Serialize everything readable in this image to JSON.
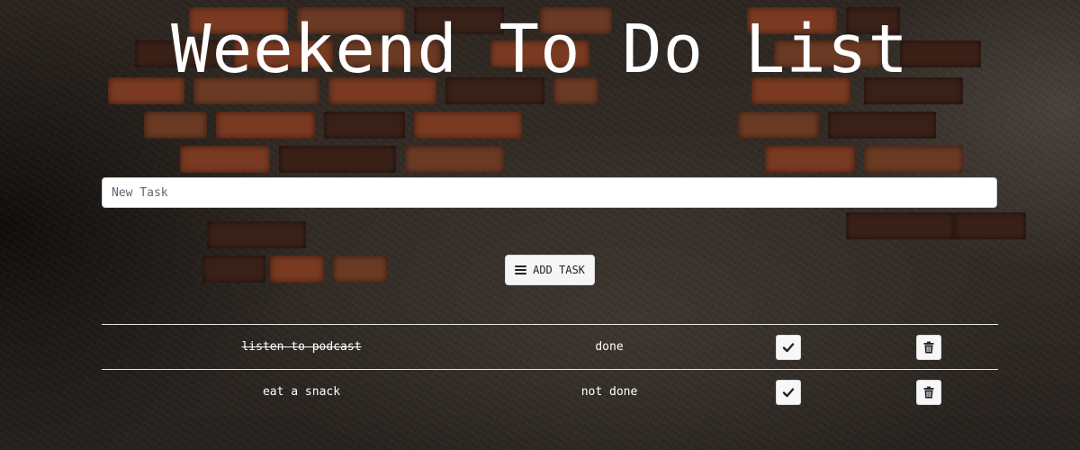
{
  "header": {
    "title": "Weekend To Do List"
  },
  "form": {
    "task_placeholder": "New Task",
    "task_value": "",
    "add_button_label": "ADD TASK",
    "add_button_icon": "bars-icon"
  },
  "tasks": [
    {
      "name": "listen to podcast",
      "status": "done",
      "completed": true,
      "complete_icon": "check-icon",
      "delete_icon": "trash-icon"
    },
    {
      "name": "eat a snack",
      "status": "not done",
      "completed": false,
      "complete_icon": "check-icon",
      "delete_icon": "trash-icon"
    }
  ],
  "colors": {
    "text": "#ffffff",
    "button_bg": "#f5f5f5",
    "icon": "#222222",
    "row_divider": "#e8e8e8"
  }
}
